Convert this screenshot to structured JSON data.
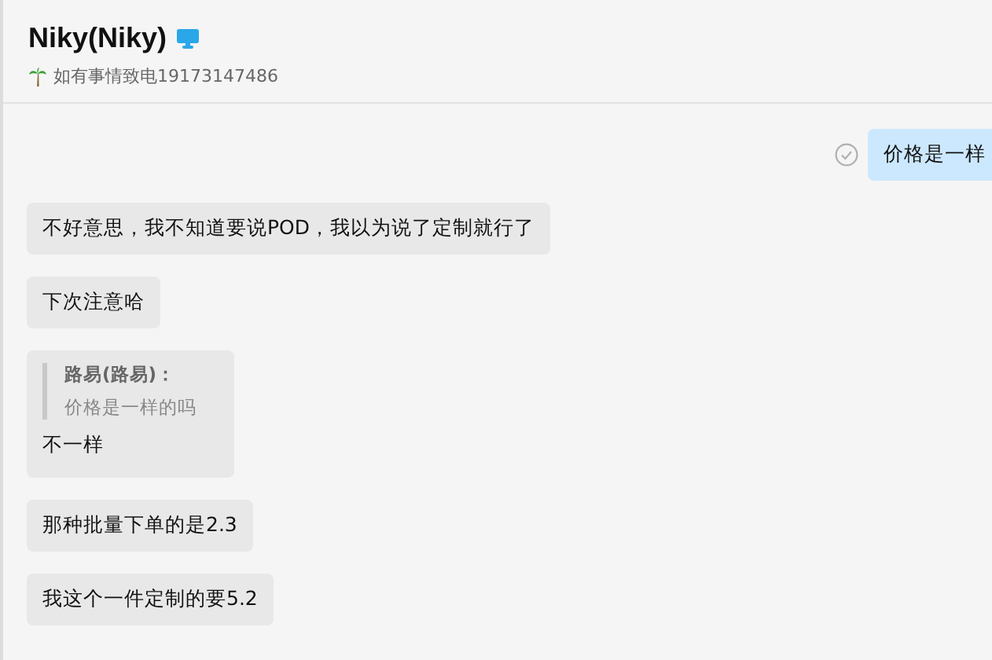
{
  "header": {
    "title": "Niky(Niky)",
    "status_text": "如有事情致电19173147486"
  },
  "messages": [
    {
      "kind": "outgoing",
      "text": "价格是一样",
      "read": true
    },
    {
      "kind": "incoming",
      "text": "不好意思，我不知道要说POD，我以为说了定制就行了"
    },
    {
      "kind": "incoming",
      "text": "下次注意哈"
    },
    {
      "kind": "quote",
      "quote_author": "路易(路易)：",
      "quote_text": "价格是一样的吗",
      "text": "不一样"
    },
    {
      "kind": "incoming",
      "text": "那种批量下单的是2.3"
    },
    {
      "kind": "incoming",
      "text": "我这个一件定制的要5.2"
    }
  ]
}
